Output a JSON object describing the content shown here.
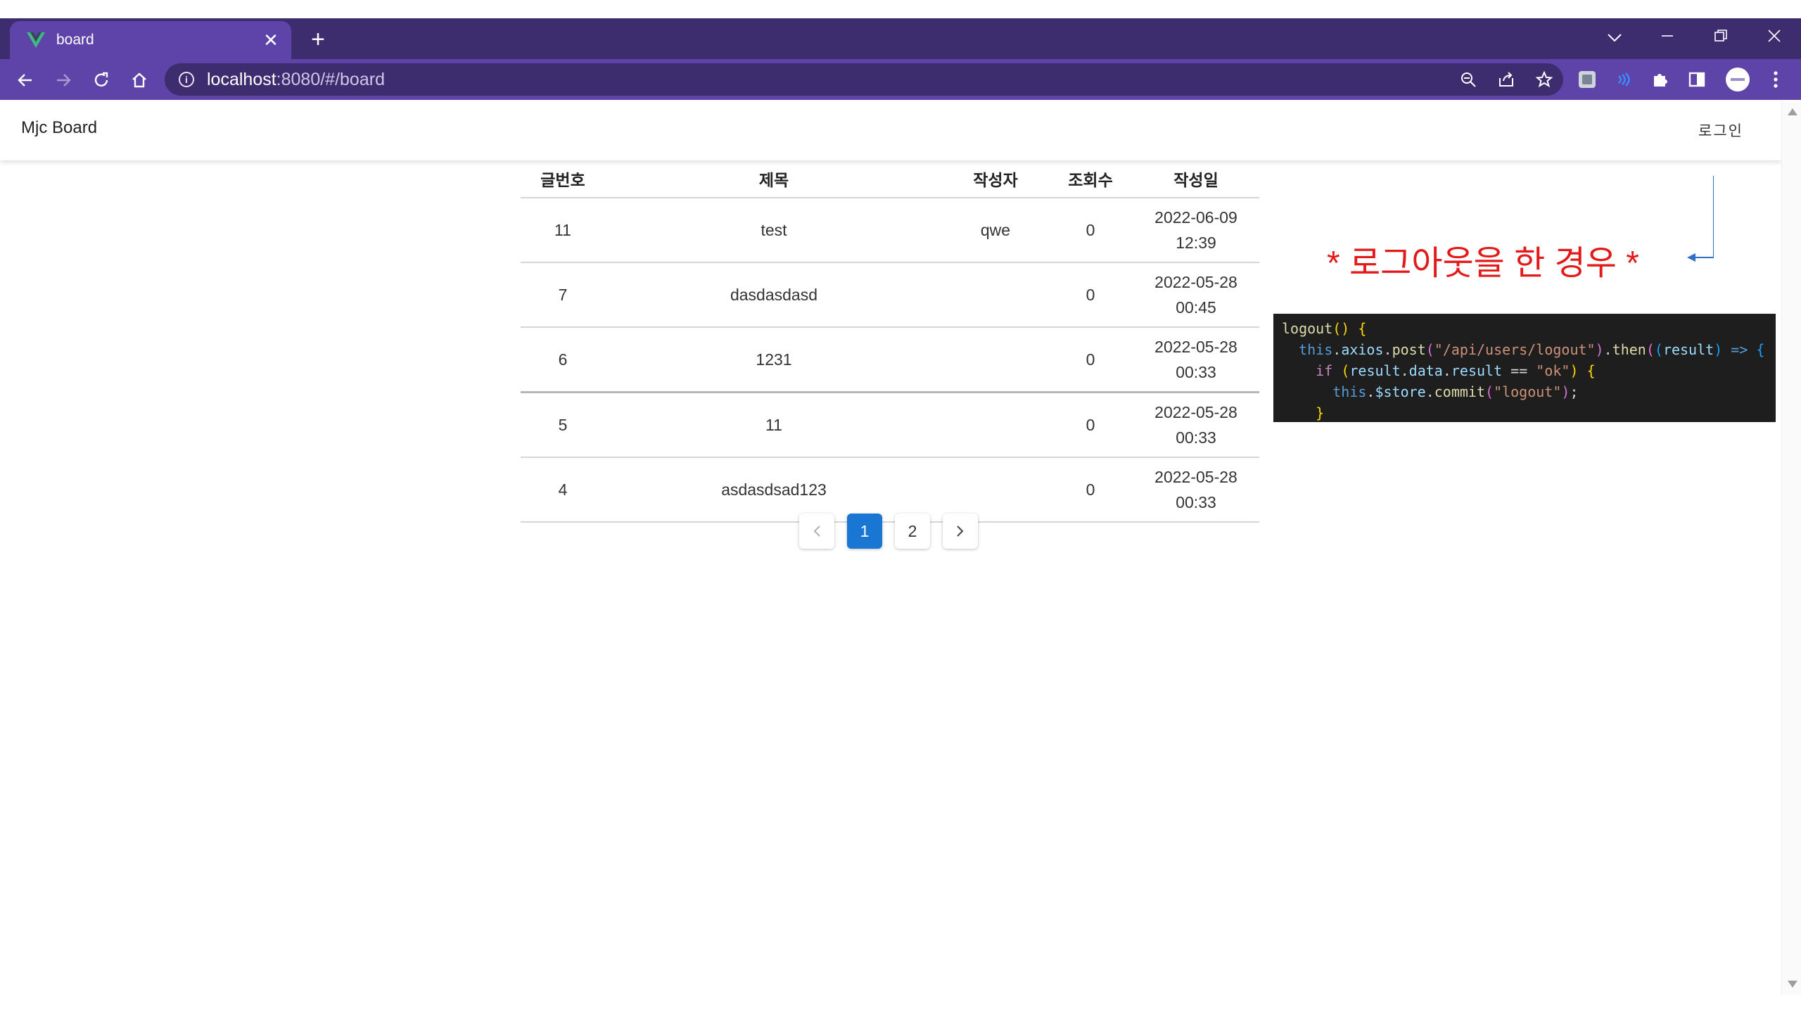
{
  "browser": {
    "tab_title": "board",
    "url_host": "localhost",
    "url_rest": ":8080/#/board"
  },
  "app": {
    "brand": "Mjc Board",
    "login_label": "로그인"
  },
  "table": {
    "headers": [
      "글번호",
      "제목",
      "작성자",
      "조회수",
      "작성일"
    ],
    "rows": [
      {
        "no": "11",
        "title": "test",
        "author": "qwe",
        "views": "0",
        "date": "2022-06-09",
        "time": "12:39"
      },
      {
        "no": "7",
        "title": "dasdasdasd",
        "author": "",
        "views": "0",
        "date": "2022-05-28",
        "time": "00:45"
      },
      {
        "no": "6",
        "title": "1231",
        "author": "",
        "views": "0",
        "date": "2022-05-28",
        "time": "00:33"
      },
      {
        "no": "5",
        "title": "11",
        "author": "",
        "views": "0",
        "date": "2022-05-28",
        "time": "00:33"
      },
      {
        "no": "4",
        "title": "asdasdsad123",
        "author": "",
        "views": "0",
        "date": "2022-05-28",
        "time": "00:33"
      }
    ]
  },
  "pagination": {
    "pages": [
      "1",
      "2"
    ],
    "current": "1"
  },
  "annotation": {
    "text": "* 로그아웃을 한 경우 *"
  },
  "colors": {
    "tab_bar": "#3d2c6e",
    "toolbar": "#5e43a8",
    "pager_active": "#1976d2",
    "annotation": "#e31a1a",
    "arrow": "#2f6fc4"
  }
}
